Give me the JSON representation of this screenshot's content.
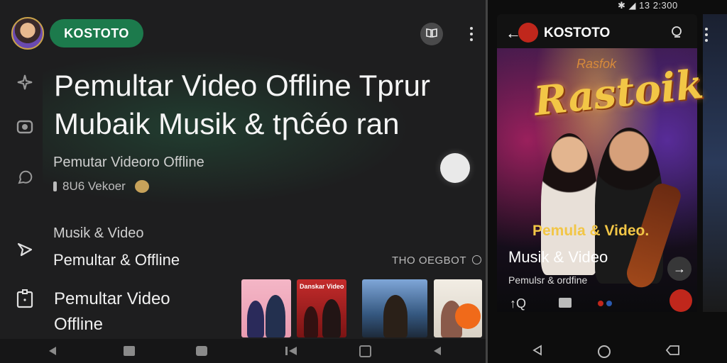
{
  "app": {
    "brand": "KOSTOTO"
  },
  "headline": {
    "line1": "Pemultar Video Offline Tprur",
    "line2": "Mubaik Musik & tꞃĉéo ran"
  },
  "meta": {
    "subtitle": "Pemutar Videoro Offline",
    "views": "8U6 Vekoer"
  },
  "section": {
    "label": "Musik & Video",
    "subtitle": "Pemultar & Offline",
    "stat": "THO OEGBOT"
  },
  "item": {
    "title_line1": "Pemultar Video",
    "title_line2": "Offline"
  },
  "thumbnails": [
    {
      "label": ""
    },
    {
      "label": "Danskar Video"
    },
    {
      "label": ""
    },
    {
      "label": ""
    }
  ],
  "phone": {
    "status_time": "13 2:300",
    "header_brand": "KOSTOTO",
    "poster_tag": "Rasfok",
    "poster_logo": "Rastoik",
    "poster_caption": "Pemula & Video.",
    "title": "Musik & Video",
    "subtitle": "Pemulsr & ordfine"
  },
  "colors": {
    "brand_green": "#1c7a4c",
    "background": "#1e1e1f",
    "accent_orange": "#f06a1a",
    "accent_red": "#c0271c",
    "poster_gold": "#f2c646"
  },
  "icons": {
    "sidebar": [
      "sparkle-icon",
      "camera-icon",
      "chat-icon",
      "send-icon",
      "clipboard-icon"
    ],
    "header": [
      "book-icon",
      "more-vertical-icon"
    ],
    "nav": [
      "back-icon",
      "square-icon",
      "stop-icon",
      "skip-back-icon",
      "home-icon",
      "back-icon"
    ],
    "phone_nav": [
      "back-icon",
      "home-icon",
      "backspace-icon"
    ]
  }
}
